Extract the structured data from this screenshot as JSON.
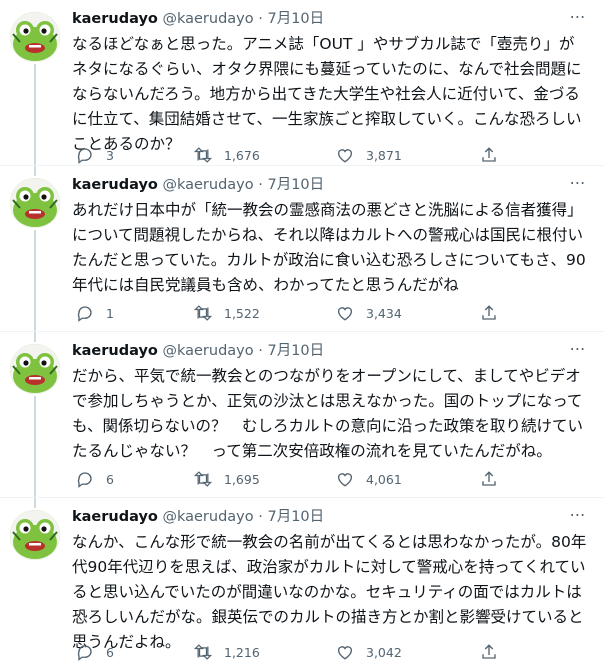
{
  "tweets": [
    {
      "name": "kaerudayo",
      "handle": "@kaerudayo",
      "separator": "·",
      "date": "7月10日",
      "text": "なるほどなぁと思った。アニメ誌「OUT 」やサブカル誌で「壺売り」がネタになるぐらい、オタク界隈にも蔓延っていたのに、なんで社会問題にならないんだろう。地方から出てきた大学生や社会人に近付いて、金づるに仕立て、集団結婚させて、一生家族ごと搾取していく。こんな恐ろしいことあるのか？",
      "replies": "3",
      "retweets": "1,676",
      "likes": "3,871"
    },
    {
      "name": "kaerudayo",
      "handle": "@kaerudayo",
      "separator": "·",
      "date": "7月10日",
      "text": "あれだけ日本中が「統一教会の霊感商法の悪どさと洗脳による信者獲得」について問題視したからね、それ以降はカルトへの警戒心は国民に根付いたんだと思っていた。カルトが政治に食い込む恐ろしさについてもさ、90年代には自民党議員も含め、わかってたと思うんだがね",
      "replies": "1",
      "retweets": "1,522",
      "likes": "3,434"
    },
    {
      "name": "kaerudayo",
      "handle": "@kaerudayo",
      "separator": "·",
      "date": "7月10日",
      "text": "だから、平気で統一教会とのつながりをオープンにして、ましてやビデオで参加しちゃうとか、正気の沙汰とは思えなかった。国のトップになっても、関係切らないの？　むしろカルトの意向に沿った政策を取り続けていたるんじゃない？　って第二次安倍政権の流れを見ていたんだがね。",
      "replies": "6",
      "retweets": "1,695",
      "likes": "4,061"
    },
    {
      "name": "kaerudayo",
      "handle": "@kaerudayo",
      "separator": "·",
      "date": "7月10日",
      "text": "なんか、こんな形で統一教会の名前が出てくるとは思わなかったが。80年代90年代辺りを思えば、政治家がカルトに対して警戒心を持ってくれていると思い込んでいたのが間違いなのかな。セキュリティの面ではカルトは恐ろしいんだがな。銀英伝でのカルトの描き方とか割と影響受けていると思うんだよね。",
      "replies": "6",
      "retweets": "1,216",
      "likes": "3,042"
    }
  ],
  "icons": {
    "avatar": "frog-avatar",
    "more": "more-icon",
    "reply": "reply-icon",
    "retweet": "retweet-icon",
    "like": "like-icon",
    "share": "share-icon"
  },
  "colors": {
    "text": "#0f1419",
    "secondary": "#536471",
    "thread_line": "#cfd9de",
    "avatar_green": "#7ec23f"
  }
}
